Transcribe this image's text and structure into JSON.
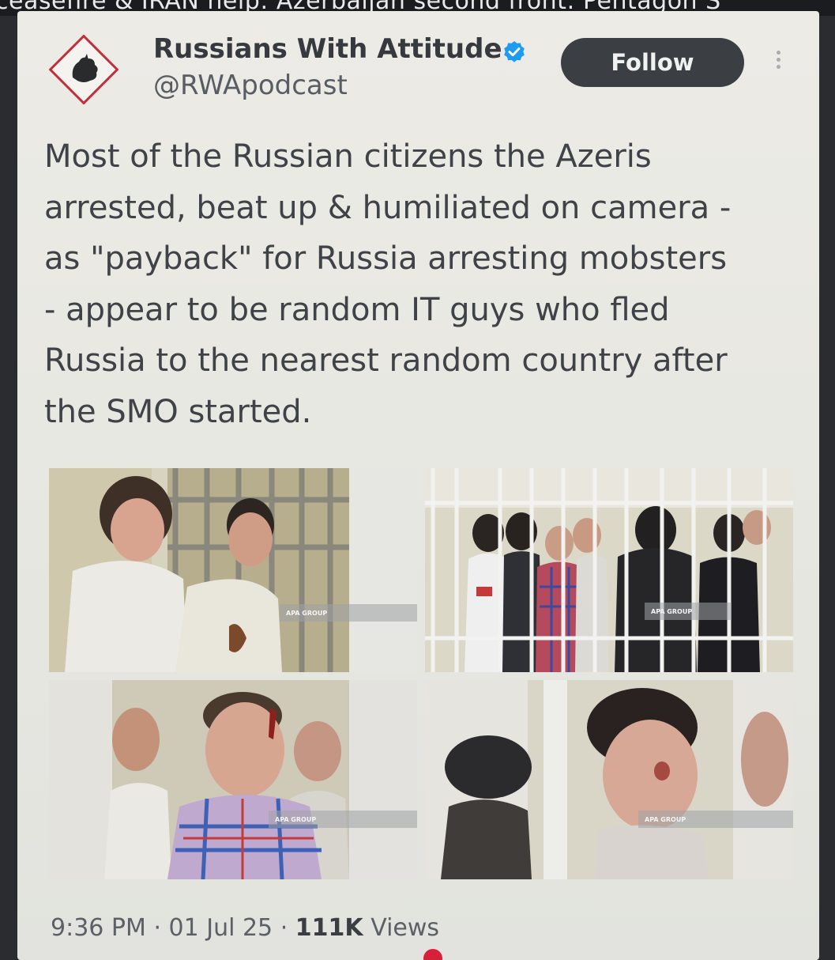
{
  "background_caption": "ceasefire & IRAN help: Azerbaijan second front: Pentagon S",
  "tweet": {
    "author_name": "Russians With Attitude",
    "handle": "@RWApodcast",
    "follow_label": "Follow",
    "text": "Most of the Russian citizens the Azeris\narrested, beat up & humiliated on camera -\nas \"payback\" for Russia arresting mobsters\n- appear to be random IT guys who fled\nRussia to the nearest random country after\nthe SMO started.",
    "time": "9:36 PM",
    "date": "01 Jul 25",
    "views_count": "111K",
    "views_label": "Views",
    "separator": "·"
  },
  "media": {
    "watermark": "APA GROUP"
  },
  "colors": {
    "verified_badge": "#1d9bf0",
    "avatar_frame": "#c0303a",
    "follow_button_bg": "#3b3e43",
    "notification_dot": "#d8203a"
  },
  "icons": [
    "rwa-logo-icon",
    "verified-badge-icon",
    "more-options-icon"
  ]
}
